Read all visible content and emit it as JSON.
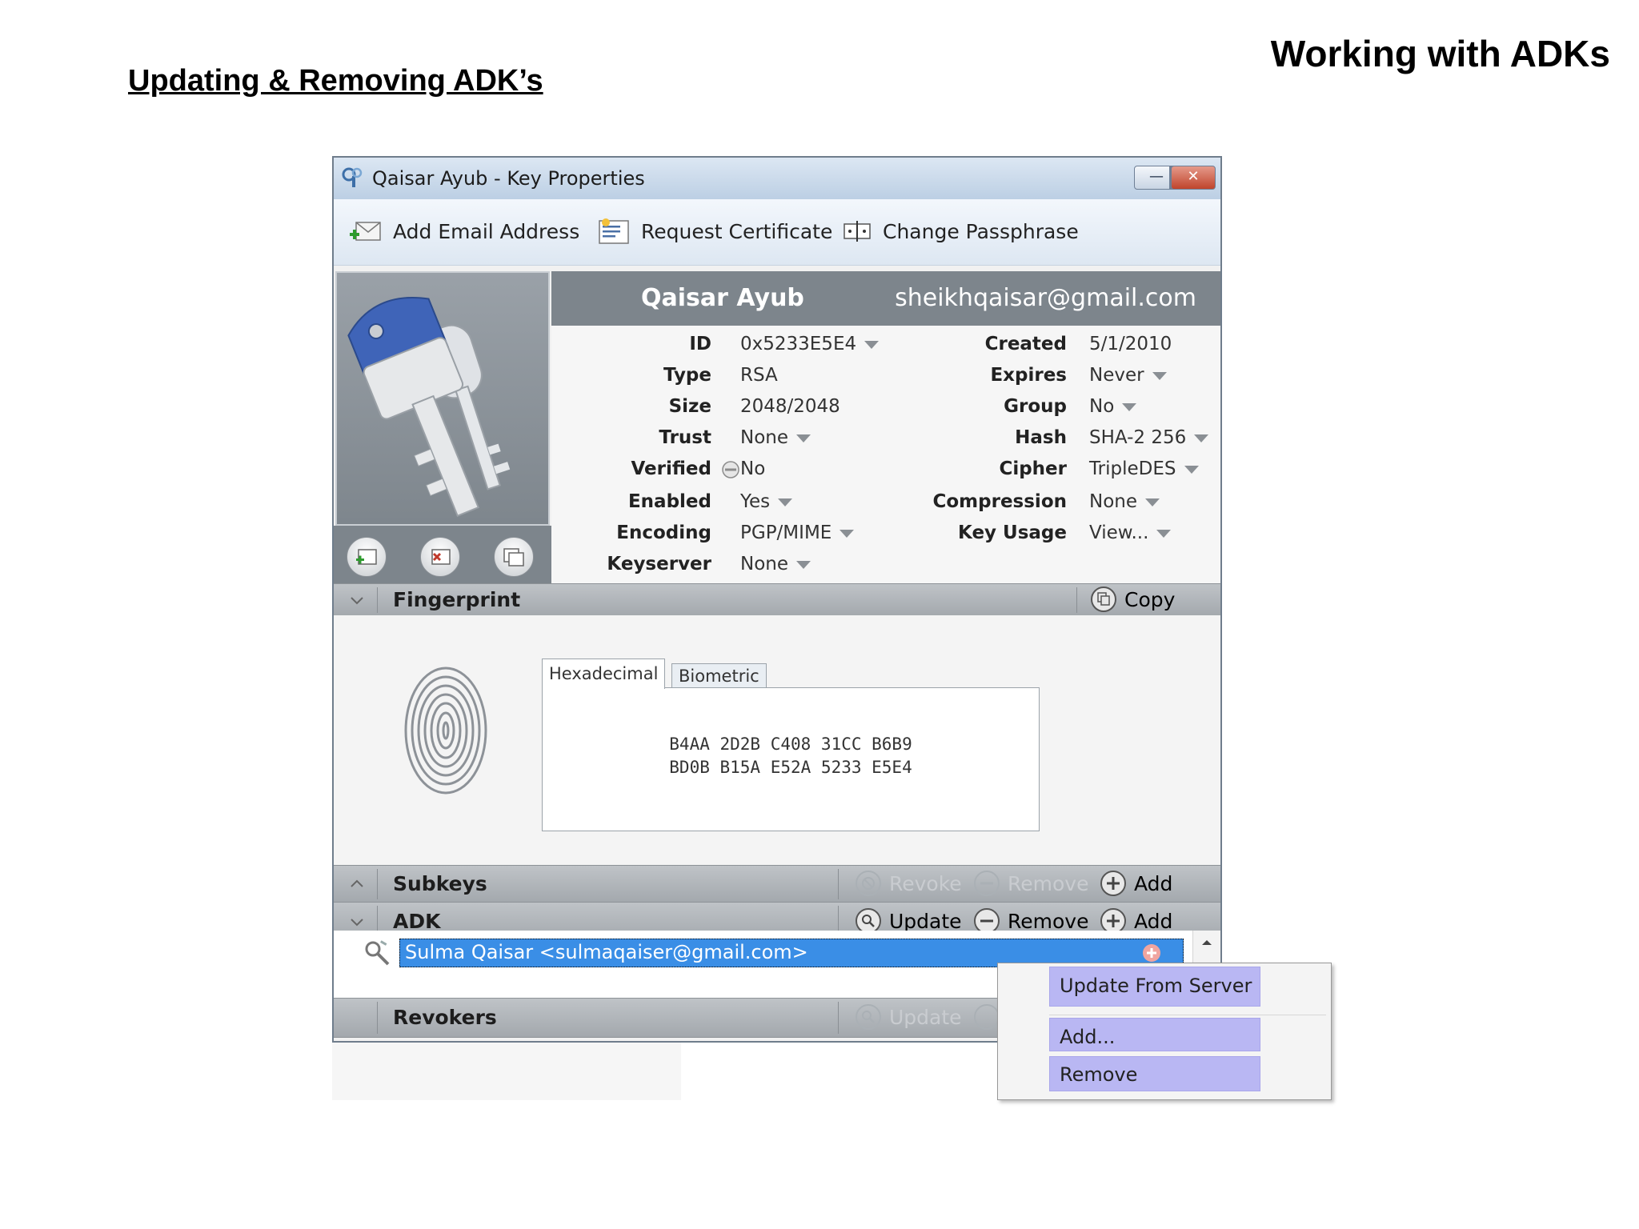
{
  "slide": {
    "title": "Working with ADKs",
    "heading": "Updating & Removing ADK’s"
  },
  "window": {
    "title": "Qaisar Ayub - Key Properties",
    "controls": {
      "minimize": "—",
      "maximize": "□",
      "close": "✕"
    }
  },
  "toolbar": {
    "add_email": "Add Email Address",
    "request_cert": "Request Certificate",
    "change_pass": "Change Passphrase"
  },
  "key": {
    "name": "Qaisar Ayub",
    "email": "sheikhqaisar@gmail.com",
    "left_props": [
      {
        "label": "ID",
        "value": "0x5233E5E4",
        "dropdown": true
      },
      {
        "label": "Type",
        "value": "RSA",
        "dropdown": false
      },
      {
        "label": "Size",
        "value": "2048/2048",
        "dropdown": false
      },
      {
        "label": "Trust",
        "value": "None",
        "dropdown": true
      },
      {
        "label": "Verified",
        "value": "No",
        "dropdown": false
      },
      {
        "label": "Enabled",
        "value": "Yes",
        "dropdown": true
      },
      {
        "label": "Encoding",
        "value": "PGP/MIME",
        "dropdown": true
      },
      {
        "label": "Keyserver",
        "value": "None",
        "dropdown": true
      }
    ],
    "right_props": [
      {
        "label": "Created",
        "value": "5/1/2010",
        "dropdown": false
      },
      {
        "label": "Expires",
        "value": "Never",
        "dropdown": true
      },
      {
        "label": "Group",
        "value": "No",
        "dropdown": true
      },
      {
        "label": "Hash",
        "value": "SHA-2 256",
        "dropdown": true
      },
      {
        "label": "Cipher",
        "value": "TripleDES",
        "dropdown": true
      },
      {
        "label": "Compression",
        "value": "None",
        "dropdown": true
      },
      {
        "label": "Key Usage",
        "value": "View...",
        "dropdown": true
      }
    ]
  },
  "fingerprint": {
    "section": "Fingerprint",
    "copy": "Copy",
    "tabs": [
      "Hexadecimal",
      "Biometric"
    ],
    "line1": "B4AA 2D2B C408 31CC B6B9",
    "line2": "BD0B B15A E52A 5233 E5E4"
  },
  "subkeys": {
    "section": "Subkeys",
    "revoke": "Revoke",
    "remove": "Remove",
    "add": "Add"
  },
  "adk": {
    "section": "ADK",
    "update": "Update",
    "remove": "Remove",
    "add": "Add",
    "entry": "Sulma Qaisar <sulmaqaiser@gmail.com>"
  },
  "revokers": {
    "section": "Revokers",
    "update": "Update"
  },
  "context_menu": {
    "update_from_server": "Update From Server",
    "add": "Add...",
    "remove": "Remove"
  },
  "colors": {
    "selection": "#3a8ee6",
    "menu_highlight": "#b9b7f3",
    "header_gray": "#7d858c"
  }
}
